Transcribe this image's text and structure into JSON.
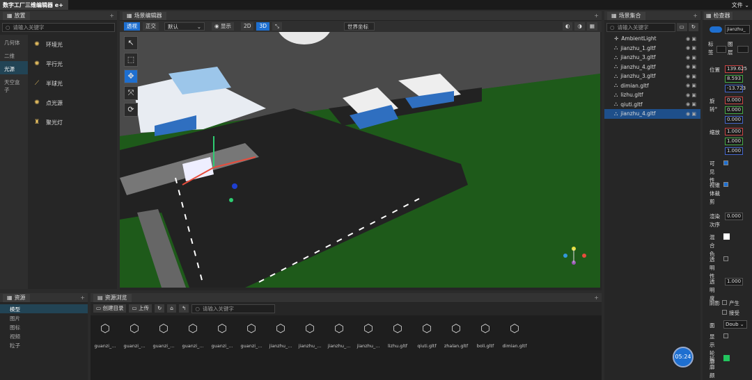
{
  "app": {
    "title": "数字工厂三维编辑器 e+",
    "menu_file": "文件"
  },
  "left_panel": {
    "title": "放置",
    "search_placeholder": "请输入关键字",
    "categories": [
      {
        "label": "几何体",
        "active": false
      },
      {
        "label": "二维",
        "active": false
      },
      {
        "label": "光源",
        "active": true
      },
      {
        "label": "天空盒子",
        "active": false
      }
    ],
    "lights": [
      {
        "label": "环境光",
        "icon": "sun-icon"
      },
      {
        "label": "平行光",
        "icon": "sun-icon"
      },
      {
        "label": "半球光",
        "icon": "hemisphere-icon"
      },
      {
        "label": "点光源",
        "icon": "bulb-icon"
      },
      {
        "label": "聚光灯",
        "icon": "spotlight-icon"
      }
    ]
  },
  "scene_editor": {
    "title": "场景编辑器",
    "perspective": "透视",
    "ortho": "正交",
    "camera": "默认",
    "display": "显示",
    "mode_2d": "2D",
    "mode_3d": "3D",
    "coord": "世界坐标"
  },
  "scene_tree": {
    "title": "场景集合",
    "search_placeholder": "请输入关键字",
    "nodes": [
      {
        "label": "AmbientLight",
        "selected": false
      },
      {
        "label": "jianzhu_1.gltf",
        "selected": false
      },
      {
        "label": "jianzhu_3.gltf",
        "selected": false
      },
      {
        "label": "jianzhu_4.gltf",
        "selected": false
      },
      {
        "label": "jianzhu_3.gltf",
        "selected": false
      },
      {
        "label": "dimian.gltf",
        "selected": false
      },
      {
        "label": "lizhu.gltf",
        "selected": false
      },
      {
        "label": "qiuti.gltf",
        "selected": false
      },
      {
        "label": "jianzhu_4.gltf",
        "selected": true
      }
    ]
  },
  "inspector": {
    "title": "检查器",
    "name_value": "jianzhu_",
    "tag_label": "标签",
    "layer_label": "图层",
    "position_label": "位置",
    "position": [
      "139.625",
      "8.593",
      "-13.723"
    ],
    "rotation_label": "旋转°",
    "rotation": [
      "0.000",
      "0.000",
      "0.000"
    ],
    "scale_label": "缩放",
    "scale": [
      "1.000",
      "1.000",
      "1.000"
    ],
    "visible_label": "可见性",
    "frustum_label": "视锥体裁剪",
    "render_order_label": "渲染次序",
    "render_order": "0.000",
    "blend_color_label": "混合色",
    "transparent_label": "透明性",
    "opacity_label": "透明度",
    "opacity": "1.000",
    "shadow_label": "阴影",
    "cast_label": "产生",
    "receive_label": "接受",
    "side_label": "面",
    "side_value": "Doub",
    "show_outline_label": "显示轮廓",
    "outline_color_label": "轮廓颜色",
    "timer": "05:24"
  },
  "assets": {
    "title": "资源",
    "categories": [
      {
        "label": "模型",
        "active": true
      },
      {
        "label": "图片",
        "active": false
      },
      {
        "label": "图标",
        "active": false
      },
      {
        "label": "视频",
        "active": false
      },
      {
        "label": "粒子",
        "active": false
      }
    ]
  },
  "asset_browser": {
    "title": "资源浏览",
    "create_dir": "创建目录",
    "upload": "上传",
    "search_placeholder": "请输入关键字",
    "files": [
      "guanzi_...",
      "guanzi_...",
      "guanzi_...",
      "guanzi_...",
      "guanzi_...",
      "guanzi_...",
      "jianzhu_...",
      "jianzhu_...",
      "jianzhu_...",
      "jianzhu_...",
      "lizhu.gltf",
      "qiuti.gltf",
      "zhalan.gltf",
      "boli.gltf",
      "dimian.gltf"
    ]
  },
  "colors": {
    "accent": "#1e6fd0",
    "grass": "#1e5a1a",
    "road": "#222222",
    "outline": "#22c55e"
  }
}
